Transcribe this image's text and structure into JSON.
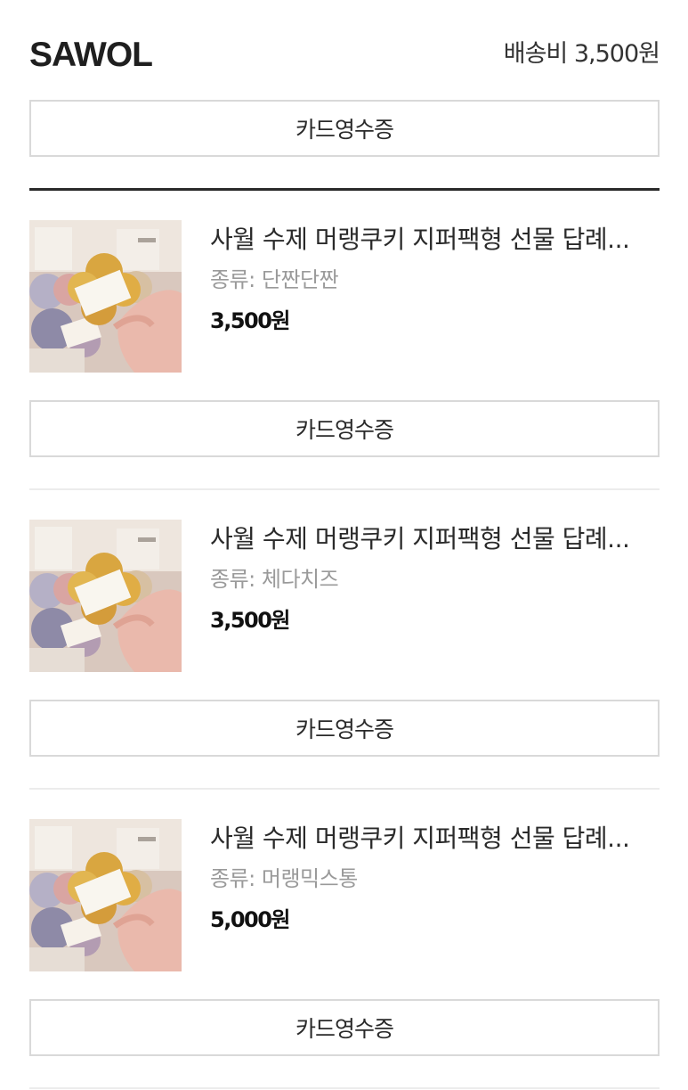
{
  "order": {
    "seller": "SAWOL",
    "shipping_fee": "배송비 3,500원",
    "top_receipt_label": "카드영수증"
  },
  "items": [
    {
      "title": "사월 수제 머랭쿠키 지퍼팩형 선물 답례...",
      "option": "종류: 단짠단짠",
      "price": "3,500원",
      "receipt_label": "카드영수증"
    },
    {
      "title": "사월 수제 머랭쿠키 지퍼팩형 선물 답례...",
      "option": "종류: 체다치즈",
      "price": "3,500원",
      "receipt_label": "카드영수증"
    },
    {
      "title": "사월 수제 머랭쿠키 지퍼팩형 선물 답례...",
      "option": "종류: 머랭믹스통",
      "price": "5,000원",
      "receipt_label": "카드영수증"
    }
  ],
  "colors": {
    "text": "#2a2a2a",
    "muted": "#9a9a9a",
    "border": "#d9d9d9",
    "divider": "#2a2a2a"
  },
  "thumbnail": {
    "label": "SAWOL"
  }
}
